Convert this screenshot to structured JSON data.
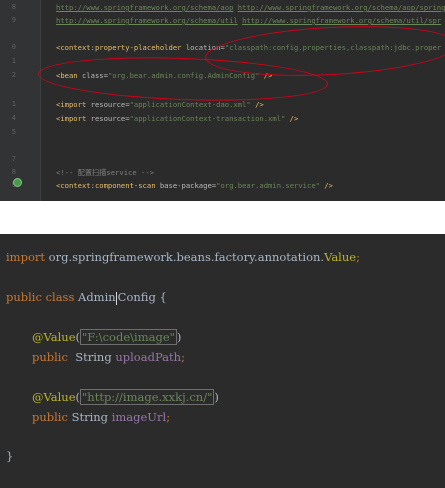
{
  "top_editor": {
    "line_numbers": [
      "8",
      "9",
      "0",
      "1",
      "2",
      "",
      "1",
      "4",
      "5",
      "",
      "7",
      "8",
      "9",
      ""
    ],
    "schema_line_1": {
      "url1": "http://www.springframework.org/schema/aop",
      "url2": "http://www.springframework.org/schema/aop/spring"
    },
    "schema_line_2": {
      "url1": "http://www.springframework.org/schema/util",
      "url2": "http://www.springframework.org/schema/util/spr"
    },
    "property_placeholder": {
      "tag": "<context:property-placeholder",
      "attr": " location=",
      "value": "\"classpath:config.properties,classpath:jdbc.proper"
    },
    "bean": {
      "tag": "<bean",
      "attr": " class=",
      "value": "\"org.bear.admin.config.AdminConfig\"",
      "close": " />"
    },
    "import_dao": {
      "tag": "<import",
      "attr": " resource=",
      "value": "\"applicationContext-dao.xml\"",
      "close": " />"
    },
    "import_tx": {
      "tag": "<import",
      "attr": " resource=",
      "value": "\"applicationContext-transaction.xml\"",
      "close": " />"
    },
    "comment": "<!-- 配置扫描service -->",
    "component_scan": {
      "tag": "<context:component-scan",
      "attr": " base-package=",
      "value": "\"org.bear.admin.service\"",
      "close": " />"
    }
  },
  "bottom_editor": {
    "import_kw": "import",
    "import_path": " org.springframework.beans.factory.annotation.",
    "import_class": "Value",
    "import_semi": ";",
    "class_kw": "public class ",
    "class_name_a": "Admin",
    "class_name_b": "Config",
    "class_open": " {",
    "ann1": "@Value",
    "ann1_open": "(",
    "ann1_value": "\"F:\\code\\image\"",
    "ann1_close": ")",
    "field1_kw": "public",
    "field1_type": "  String ",
    "field1_name": "uploadPath",
    "field1_semi": ";",
    "ann2": "@Value",
    "ann2_open": "(",
    "ann2_value": "\"http://image.xxkj.cn/\"",
    "ann2_close": ")",
    "field2_kw": "public",
    "field2_type": " String ",
    "field2_name": "imageUrl",
    "field2_semi": ";",
    "class_close": "}"
  },
  "colors": {
    "editor_bg": "#2b2b2b",
    "annotation_oval": "#d0021b",
    "keyword": "#cc7832",
    "string": "#6a8759",
    "tag": "#e8bf6a",
    "field": "#9876aa"
  }
}
